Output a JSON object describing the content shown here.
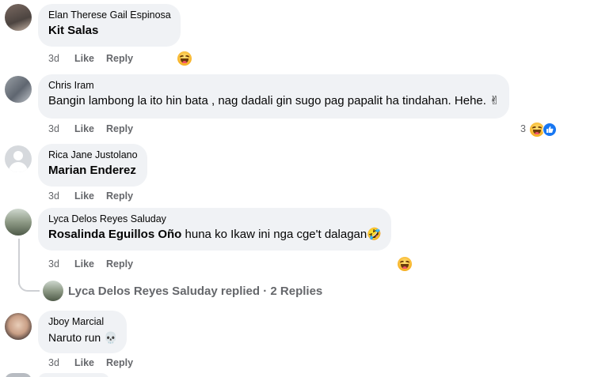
{
  "comments": [
    {
      "author": "Elan Therese Gail Espinosa",
      "mention": "Kit Salas",
      "text": "",
      "time": "3d",
      "like": "Like",
      "reply": "Reply",
      "reactions": [
        "haha"
      ]
    },
    {
      "author": "Chris Iram",
      "mention": "",
      "text": "Bangin lambong la ito hin bata , nag dadali gin sugo pag papalit ha tindahan. Hehe. ✌",
      "time": "3d",
      "like": "Like",
      "reply": "Reply",
      "reaction_count": "3",
      "reactions": [
        "haha",
        "like"
      ]
    },
    {
      "author": "Rica Jane Justolano",
      "mention": "Marian Enderez",
      "text": "",
      "time": "3d",
      "like": "Like",
      "reply": "Reply",
      "reactions": []
    },
    {
      "author": "Lyca Delos Reyes Saluday",
      "mention": "Rosalinda Eguillos Oño",
      "text": " huna ko Ikaw ini nga cge't dalagan🤣",
      "time": "3d",
      "like": "Like",
      "reply": "Reply",
      "reactions": [
        "haha"
      ]
    },
    {
      "author": "Jboy Marcial",
      "mention": "",
      "text": "Naruto run 💀",
      "time": "3d",
      "like": "Like",
      "reply": "Reply",
      "reactions": []
    }
  ],
  "replies_summary": {
    "text": "Lyca Delos Reyes Saluday replied · 2 Replies"
  },
  "colors": {
    "bubble": "#f0f2f5",
    "secondary_text": "#65676b",
    "like_blue": "#1877f2"
  }
}
